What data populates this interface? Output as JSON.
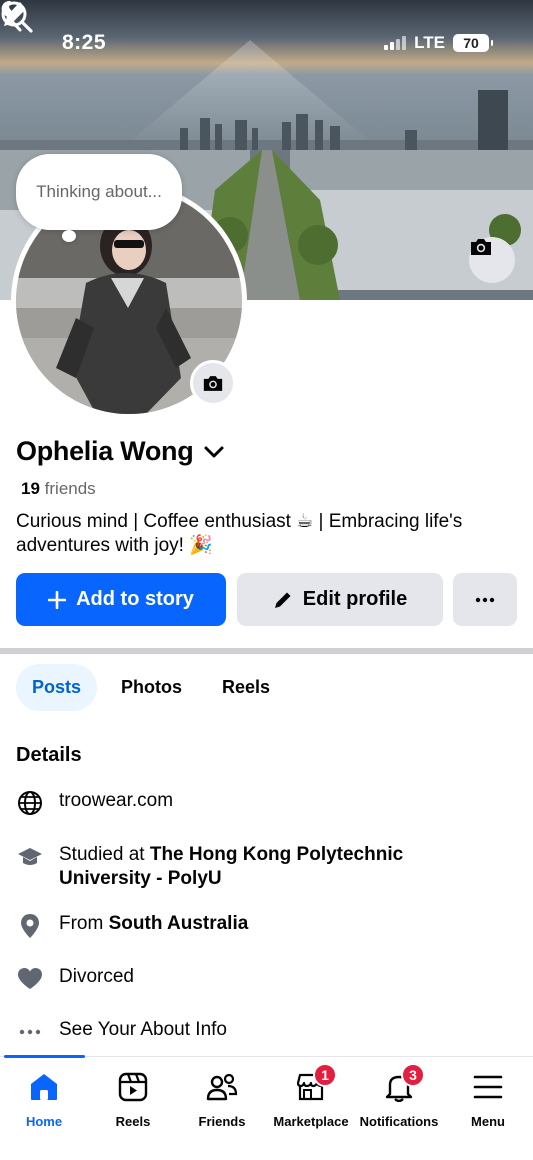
{
  "status_bar": {
    "time": "8:25",
    "network": "LTE",
    "battery": "70"
  },
  "thought_bubble": {
    "placeholder": "Thinking about..."
  },
  "profile": {
    "name": "Ophelia Wong",
    "friends_count": "19",
    "friends_label": "friends",
    "bio": "Curious mind | Coffee enthusiast ☕ | Embracing life's adventures with joy! 🎉"
  },
  "actions": {
    "add_story": "Add to story",
    "edit_profile": "Edit profile",
    "more": "···"
  },
  "tabs": [
    {
      "label": "Posts",
      "active": true
    },
    {
      "label": "Photos",
      "active": false
    },
    {
      "label": "Reels",
      "active": false
    }
  ],
  "details": {
    "title": "Details",
    "website": "troowear.com",
    "education_prefix": "Studied at ",
    "education_school": "The Hong Kong Polytechnic University - PolyU",
    "from_prefix": "From ",
    "from_place": "South Australia",
    "relationship": "Divorced",
    "about": "See Your About Info"
  },
  "nav": {
    "items": [
      {
        "label": "Home",
        "icon": "home-icon",
        "active": true
      },
      {
        "label": "Reels",
        "icon": "reels-icon"
      },
      {
        "label": "Friends",
        "icon": "friends-icon"
      },
      {
        "label": "Marketplace",
        "icon": "marketplace-icon",
        "badge": "1"
      },
      {
        "label": "Notifications",
        "icon": "bell-icon",
        "badge": "3"
      },
      {
        "label": "Menu",
        "icon": "menu-icon"
      }
    ]
  },
  "colors": {
    "primary": "#0866ff",
    "badge": "#e41e3f",
    "secondary_button": "#e4e6eb",
    "muted_text": "#65676b"
  }
}
